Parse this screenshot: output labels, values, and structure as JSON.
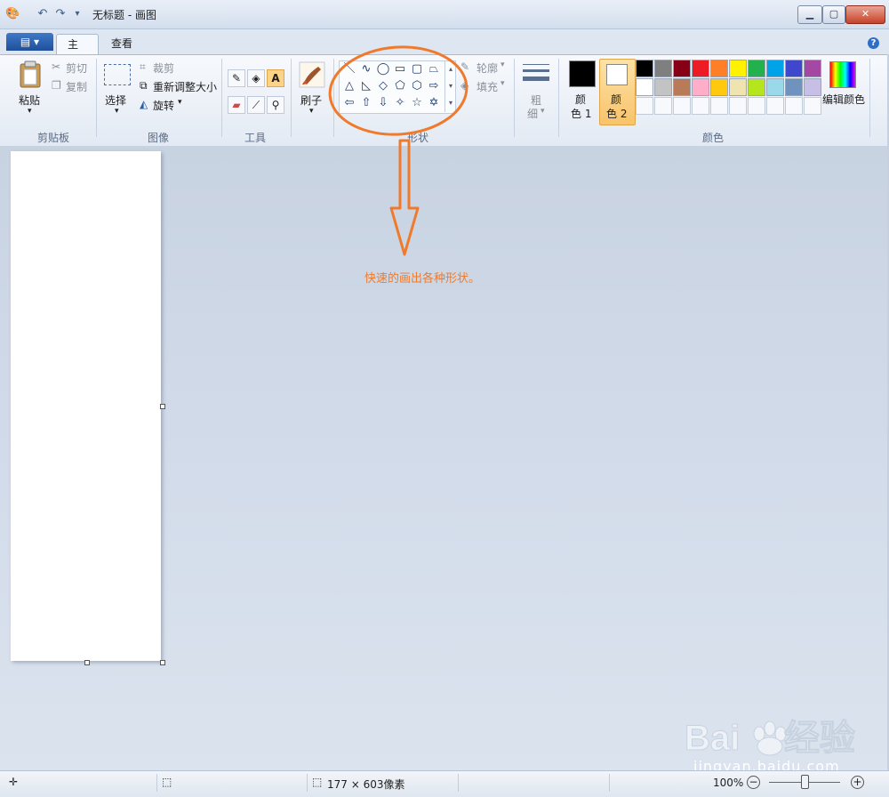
{
  "window": {
    "title": "无标题 - 画图"
  },
  "tabs": {
    "app_menu": "▤ ▾",
    "home": "主页",
    "view": "查看"
  },
  "clipboard": {
    "paste": "粘贴",
    "cut": "剪切",
    "copy": "复制",
    "group": "剪贴板"
  },
  "image": {
    "select": "选择",
    "crop": "裁剪",
    "resize": "重新调整大小",
    "rotate": "旋转",
    "group": "图像"
  },
  "tools": {
    "group": "工具"
  },
  "brushes": {
    "label": "刷子"
  },
  "shapes": {
    "group": "形状",
    "outline": "轮廓",
    "fill": "填充",
    "items": [
      "line",
      "curve",
      "oval",
      "rectangle",
      "rounded-rectangle",
      "polygon",
      "triangle",
      "right-triangle",
      "diamond",
      "pentagon",
      "hexagon",
      "right-arrow",
      "left-arrow",
      "up-arrow",
      "down-arrow",
      "four-point-star",
      "five-point-star",
      "six-point-star"
    ]
  },
  "size": {
    "label_line1": "粗",
    "label_line2": "细"
  },
  "colors": {
    "group": "颜色",
    "color1_l1": "颜",
    "color1_l2": "色 1",
    "color2_l1": "颜",
    "color2_l2": "色 2",
    "edit": "编辑颜色",
    "row1": [
      "#000000",
      "#7f7f7f",
      "#880015",
      "#ed1c24",
      "#ff7f27",
      "#fff200",
      "#22b14c",
      "#00a2e8",
      "#3f48cc",
      "#a349a4"
    ],
    "row2": [
      "#ffffff",
      "#c3c3c3",
      "#b97a57",
      "#ffaec9",
      "#ffc90e",
      "#efe4b0",
      "#b5e61d",
      "#99d9ea",
      "#7092be",
      "#c8bfe7"
    ]
  },
  "annotation": {
    "text": "快速的画出各种形状。"
  },
  "status": {
    "canvas_size": "177 × 603像素",
    "zoom": "100%"
  },
  "watermark": {
    "url": "jingyan.baidu.com"
  }
}
